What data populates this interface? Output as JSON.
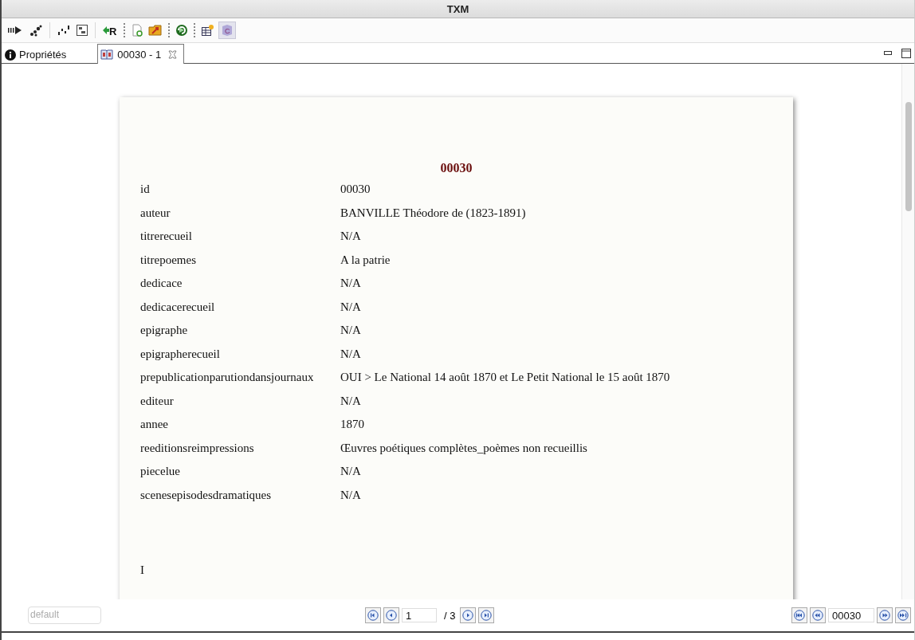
{
  "window": {
    "title": "TXM"
  },
  "toolbar": {
    "r_glyph": "R",
    "c_glyph": "C"
  },
  "tabs": [
    {
      "label": "Propriétés",
      "selected": false,
      "kind": "info",
      "closable": false
    },
    {
      "label": "00030 - 1",
      "selected": true,
      "kind": "edition",
      "closable": true
    }
  ],
  "document": {
    "title": "00030",
    "metadata": [
      {
        "key": "id",
        "value": "00030"
      },
      {
        "key": "auteur",
        "value": "BANVILLE Théodore de (1823-1891)"
      },
      {
        "key": "titrerecueil",
        "value": "N/A"
      },
      {
        "key": "titrepoemes",
        "value": "A la patrie"
      },
      {
        "key": "dedicace",
        "value": "N/A"
      },
      {
        "key": "dedicacerecueil",
        "value": "N/A"
      },
      {
        "key": "epigraphe",
        "value": "N/A"
      },
      {
        "key": "epigrapherecueil",
        "value": "N/A"
      },
      {
        "key": "prepublicationparutiondansjournaux",
        "value": "OUI > Le National 14 août 1870 et Le Petit National le 15 août 1870"
      },
      {
        "key": "editeur",
        "value": "N/A"
      },
      {
        "key": "annee",
        "value": "1870"
      },
      {
        "key": "reeditionsreimpressions",
        "value": "Œuvres poétiques complètes_poèmes non recueillis"
      },
      {
        "key": "piecelue",
        "value": "N/A"
      },
      {
        "key": "scenesepisodesdramatiques",
        "value": "N/A"
      }
    ],
    "section_heading": "I"
  },
  "footer": {
    "style_button": {
      "label": "default",
      "disabled": true
    },
    "page_nav": {
      "page": "1",
      "total": "/ 3"
    },
    "text_nav": {
      "text_id": "00030"
    }
  }
}
